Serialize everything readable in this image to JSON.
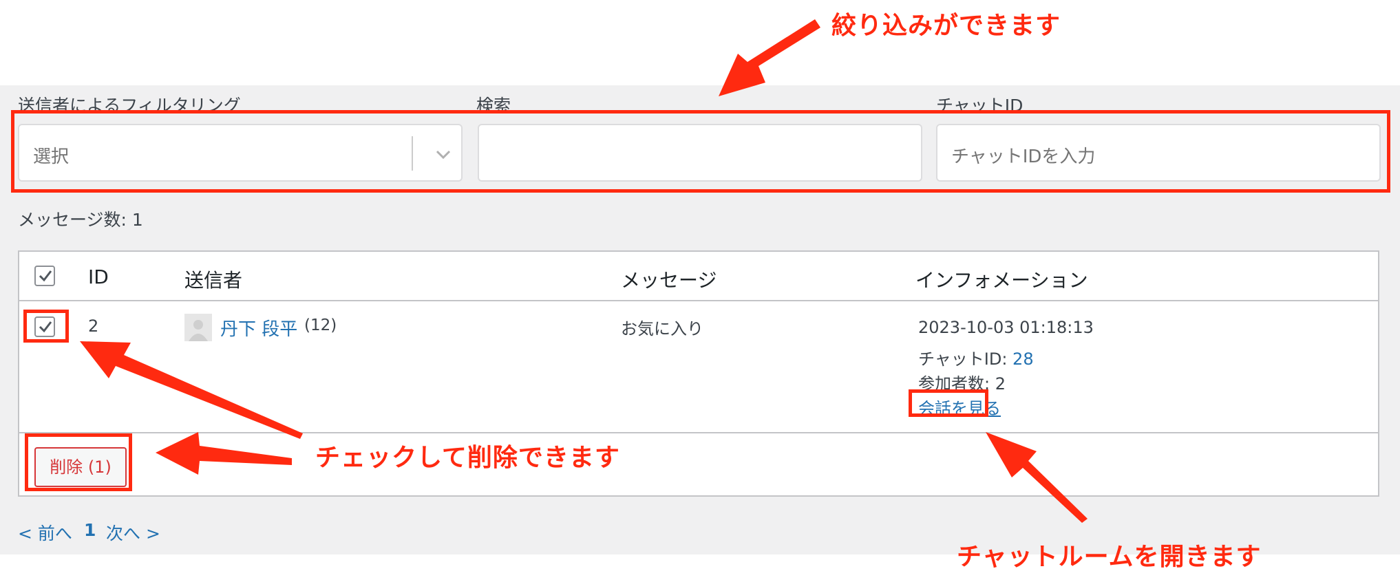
{
  "filters": {
    "sender_label": "送信者によるフィルタリング",
    "sender_placeholder": "選択",
    "search_label": "検索",
    "search_value": "",
    "chat_id_label": "チャットID",
    "chat_id_placeholder": "チャットIDを入力"
  },
  "message_count": "メッセージ数: 1",
  "table": {
    "columns": [
      "ID",
      "送信者",
      "メッセージ",
      "インフォメーション"
    ],
    "rows": [
      {
        "checked": true,
        "id": "2",
        "sender_name": "丹下 段平",
        "sender_count": "(12)",
        "message": "お気に入り",
        "datetime": "2023-10-03 01:18:13",
        "chat_id_label": "チャットID: ",
        "chat_id_value": "28",
        "participants": "参加者数: 2",
        "view_link": "会話を見る"
      }
    ],
    "delete_button": "削除 (1)"
  },
  "pagination": {
    "prev": "< 前へ",
    "current": "1",
    "next": "次へ >"
  },
  "annotations": {
    "filter_note": "絞り込みができます",
    "delete_note": "チェックして削除できます",
    "chatroom_note": "チャットルームを開きます"
  },
  "colors": {
    "annotation_red": "#ff2a10",
    "link_blue": "#2271b1",
    "delete_red": "#d63638",
    "admin_background": "#f0f0f1"
  }
}
